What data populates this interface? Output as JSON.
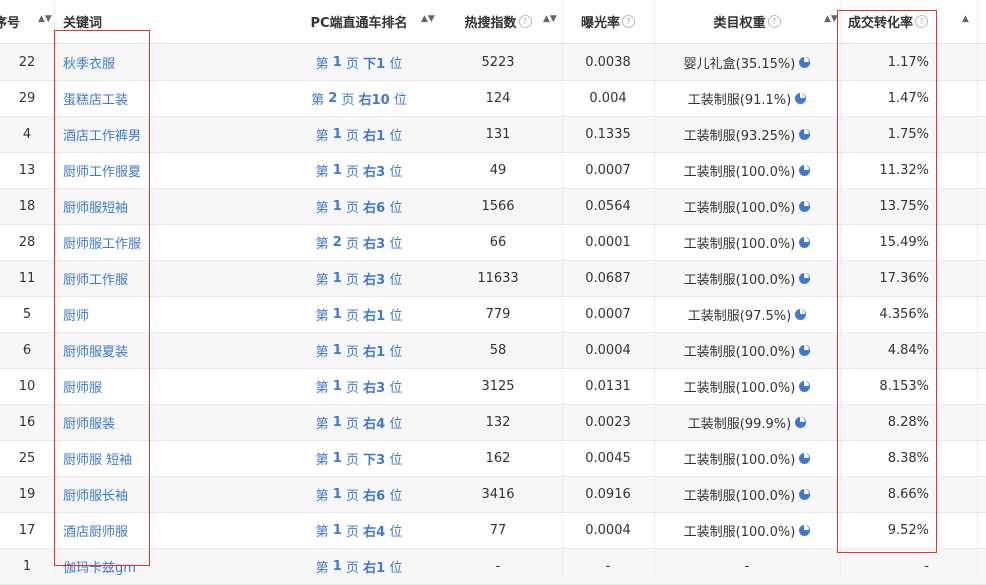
{
  "header": {
    "no": "序号",
    "keyword": "关键词",
    "rank": "PC端直通车排名",
    "hot": "热搜指数",
    "exposure": "曝光率",
    "category": "类目权重",
    "cvr": "成交转化率",
    "help_icon": "?"
  },
  "rank_words": {
    "page_prefix": "第",
    "page_suffix": "页"
  },
  "rows": [
    {
      "no": "22",
      "keyword": "秋季衣服",
      "page": "1",
      "pos": "下1",
      "unit": "位",
      "hot": "5223",
      "exp": "0.0038",
      "cat": "婴儿礼盒(35.15%)",
      "cvr": "1.17%"
    },
    {
      "no": "29",
      "keyword": "蛋糕店工装",
      "page": "2",
      "pos": "右10",
      "unit": "位",
      "hot": "124",
      "exp": "0.004",
      "cat": "工装制服(91.1%)",
      "cvr": "1.47%"
    },
    {
      "no": "4",
      "keyword": "酒店工作裤男",
      "page": "1",
      "pos": "右1",
      "unit": "位",
      "hot": "131",
      "exp": "0.1335",
      "cat": "工装制服(93.25%)",
      "cvr": "1.75%"
    },
    {
      "no": "13",
      "keyword": "厨师工作服夏",
      "page": "1",
      "pos": "右3",
      "unit": "位",
      "hot": "49",
      "exp": "0.0007",
      "cat": "工装制服(100.0%)",
      "cvr": "11.32%"
    },
    {
      "no": "18",
      "keyword": "厨师服短袖",
      "page": "1",
      "pos": "右6",
      "unit": "位",
      "hot": "1566",
      "exp": "0.0564",
      "cat": "工装制服(100.0%)",
      "cvr": "13.75%"
    },
    {
      "no": "28",
      "keyword": "厨师服工作服",
      "page": "2",
      "pos": "右3",
      "unit": "位",
      "hot": "66",
      "exp": "0.0001",
      "cat": "工装制服(100.0%)",
      "cvr": "15.49%"
    },
    {
      "no": "11",
      "keyword": "厨师工作服",
      "page": "1",
      "pos": "右3",
      "unit": "位",
      "hot": "11633",
      "exp": "0.0687",
      "cat": "工装制服(100.0%)",
      "cvr": "17.36%"
    },
    {
      "no": "5",
      "keyword": "厨师",
      "page": "1",
      "pos": "右1",
      "unit": "位",
      "hot": "779",
      "exp": "0.0007",
      "cat": "工装制服(97.5%)",
      "cvr": "4.356%"
    },
    {
      "no": "6",
      "keyword": "厨师服夏装",
      "page": "1",
      "pos": "右1",
      "unit": "位",
      "hot": "58",
      "exp": "0.0004",
      "cat": "工装制服(100.0%)",
      "cvr": "4.84%"
    },
    {
      "no": "10",
      "keyword": "厨师服",
      "page": "1",
      "pos": "右3",
      "unit": "位",
      "hot": "3125",
      "exp": "0.0131",
      "cat": "工装制服(100.0%)",
      "cvr": "8.153%"
    },
    {
      "no": "16",
      "keyword": "厨师服装",
      "page": "1",
      "pos": "右4",
      "unit": "位",
      "hot": "132",
      "exp": "0.0023",
      "cat": "工装制服(99.9%)",
      "cvr": "8.28%"
    },
    {
      "no": "25",
      "keyword": "厨师服 短袖",
      "page": "1",
      "pos": "下3",
      "unit": "位",
      "hot": "162",
      "exp": "0.0045",
      "cat": "工装制服(100.0%)",
      "cvr": "8.38%"
    },
    {
      "no": "19",
      "keyword": "厨师服长袖",
      "page": "1",
      "pos": "右6",
      "unit": "位",
      "hot": "3416",
      "exp": "0.0916",
      "cat": "工装制服(100.0%)",
      "cvr": "8.66%"
    },
    {
      "no": "17",
      "keyword": "酒店厨师服",
      "page": "1",
      "pos": "右4",
      "unit": "位",
      "hot": "77",
      "exp": "0.0004",
      "cat": "工装制服(100.0%)",
      "cvr": "9.52%"
    },
    {
      "no": "1",
      "keyword": "伽玛卡兹gm",
      "page": "1",
      "pos": "右1",
      "unit": "位",
      "hot": "-",
      "exp": "-",
      "cat": "-",
      "cvr": "-"
    }
  ]
}
